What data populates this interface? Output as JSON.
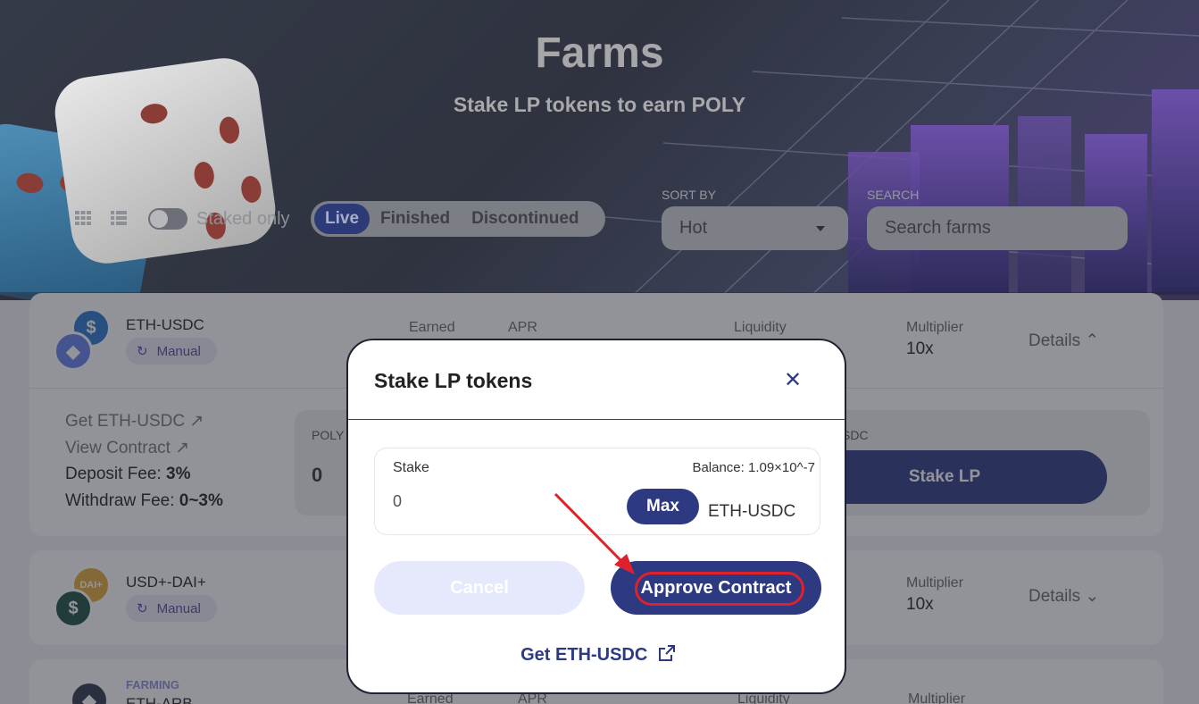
{
  "hero": {
    "title": "Farms",
    "subtitle": "Stake LP tokens to earn POLY"
  },
  "filters": {
    "staked_only_label": "Staked only",
    "tabs": [
      "Live",
      "Finished",
      "Discontinued"
    ],
    "active_tab": "Live",
    "sort_label": "SORT BY",
    "sort_value": "Hot",
    "search_label": "SEARCH",
    "search_placeholder": "Search farms"
  },
  "farms": [
    {
      "pair": "ETH-USDC",
      "badge": "Manual",
      "earned_label": "Earned",
      "apr_label": "APR",
      "liquidity_label": "Liquidity",
      "multiplier_label": "Multiplier",
      "multiplier": "10x",
      "details_label": "Details",
      "get_link": "Get ETH-USDC",
      "view_contract": "View Contract",
      "deposit_fee_label": "Deposit Fee:",
      "deposit_fee": "3%",
      "withdraw_fee_label": "Withdraw Fee:",
      "withdraw_fee": "0~3%",
      "poly_label": "POLY",
      "poly_value": "0",
      "lp_label": "SDC",
      "stake_btn": "Stake LP"
    },
    {
      "pair": "USD+-DAI+",
      "badge": "Manual",
      "multiplier_label": "Multiplier",
      "multiplier": "10x",
      "details_label": "Details"
    },
    {
      "pair": "ETH-ARB",
      "tag": "FARMING",
      "earned_label": "Earned",
      "apr_label": "APR",
      "liquidity_label": "Liquidity",
      "multiplier_label": "Multiplier"
    }
  ],
  "modal": {
    "title": "Stake LP tokens",
    "stake_label": "Stake",
    "balance": "Balance: 1.09×10^-7",
    "amount": "0",
    "max_label": "Max",
    "unit": "ETH-USDC",
    "cancel_label": "Cancel",
    "approve_label": "Approve Contract",
    "get_link": "Get ETH-USDC"
  },
  "colors": {
    "primary": "#2d3a82",
    "highlight": "#e0212b",
    "cancel_bg": "#e6e9fb"
  }
}
